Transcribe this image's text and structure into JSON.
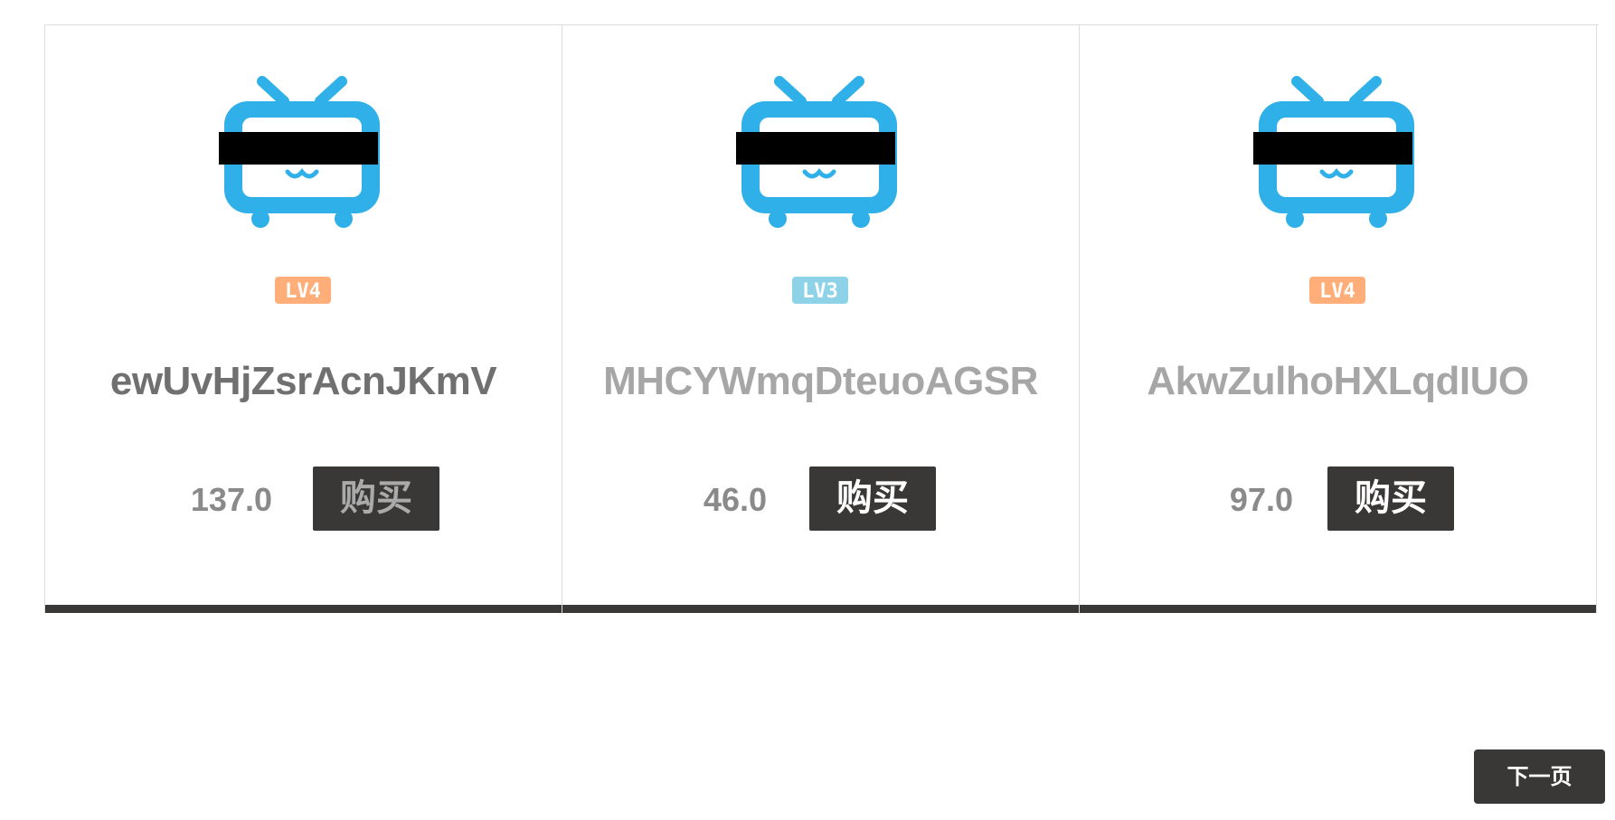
{
  "cards": [
    {
      "username": "ewUvHjZsrAcnJKmV",
      "username_color": "#707070",
      "level": "LV4",
      "level_color": "#ffae7a",
      "price": "137.0",
      "buy_label": "购买",
      "buy_label_color": "#aaaaaa",
      "avatar_icon": "tv-mascot-icon-censored"
    },
    {
      "username": "MHCYWmqDteuoAGSR",
      "username_color": "#a6a6a6",
      "level": "LV3",
      "level_color": "#8ed2e8",
      "price": "46.0",
      "buy_label": "购买",
      "buy_label_color": "#ffffff",
      "avatar_icon": "tv-mascot-icon-censored"
    },
    {
      "username": "AkwZulhoHXLqdIUO",
      "username_color": "#a6a6a6",
      "level": "LV4",
      "level_color": "#ffae7a",
      "price": "97.0",
      "buy_label": "购买",
      "buy_label_color": "#ffffff",
      "avatar_icon": "tv-mascot-icon-censored"
    }
  ],
  "pagination": {
    "next_label": "下一页"
  },
  "colors": {
    "dark": "#3a3836",
    "avatar_blue": "#2fb0e8",
    "border": "#dddddd"
  }
}
